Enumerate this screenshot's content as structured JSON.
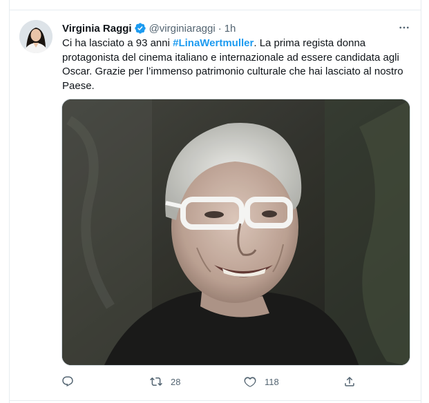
{
  "tweet": {
    "author_name": "Virginia Raggi",
    "handle": "@virginiaraggi",
    "separator": "·",
    "time": "1h",
    "text_before": "Ci ha lasciato a 93 anni ",
    "hashtag": "#LinaWertmuller",
    "text_after": ". La prima regista donna protagonista del cinema italiano e internazionale ad essere candidata agli Oscar. Grazie per l’immenso patrimonio culturale che hai lasciato al nostro Paese."
  },
  "actions": {
    "reply_count": "",
    "retweet_count": "28",
    "like_count": "118"
  },
  "icons": {
    "verified": "verified-badge-icon",
    "more": "more-horizontal-icon",
    "reply": "reply-icon",
    "retweet": "retweet-icon",
    "like": "heart-icon",
    "share": "share-icon"
  },
  "colors": {
    "accent": "#1d9bf0",
    "text_primary": "#0f1419",
    "text_secondary": "#536471",
    "border": "#cfd9de"
  }
}
